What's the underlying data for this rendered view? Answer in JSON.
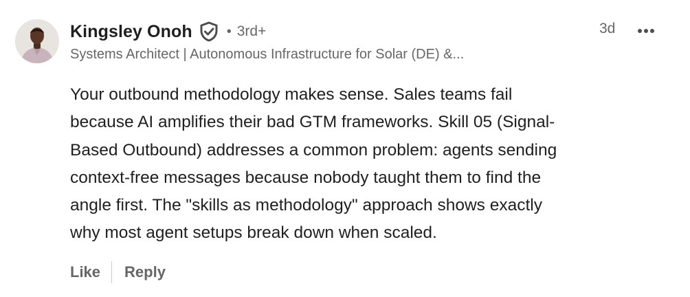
{
  "comment": {
    "author": {
      "name": "Kingsley Onoh",
      "verified_icon": "shield-check-icon",
      "separator": "•",
      "degree": "3rd+",
      "headline": "Systems Architect | Autonomous Infrastructure for Solar (DE) &..."
    },
    "time": "3d",
    "more_icon": "ellipsis-icon",
    "text": "Your outbound methodology makes sense. Sales teams fail\nbecause AI amplifies their bad GTM frameworks. Skill 05 (Signal-\nBased Outbound) addresses a common problem: agents sending\ncontext-free messages because nobody taught them to find the\nangle first. The \"skills as methodology\" approach shows exactly\nwhy most agent setups break down when scaled.",
    "actions": {
      "like_label": "Like",
      "reply_label": "Reply"
    }
  },
  "colors": {
    "text_primary": "#1f1f1f",
    "text_secondary": "#666666",
    "divider": "#c9c9c9",
    "background": "#ffffff"
  }
}
